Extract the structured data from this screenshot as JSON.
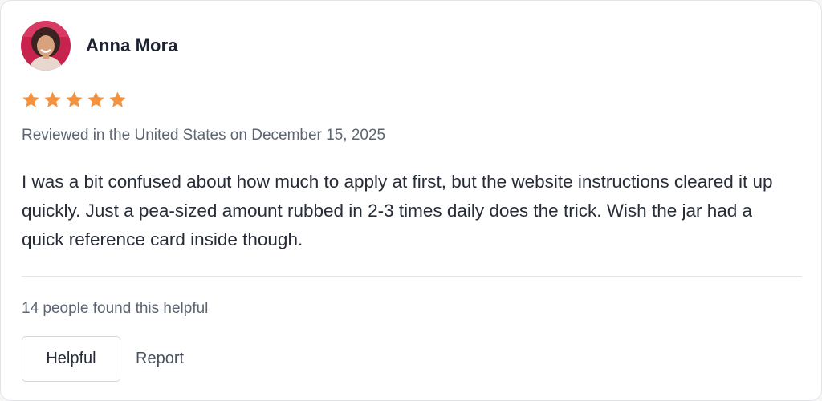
{
  "review": {
    "reviewer_name": "Anna Mora",
    "avatar_icon": "reviewer-photo",
    "rating": 5,
    "rating_max": 5,
    "star_color": "#f5923e",
    "meta": "Reviewed in the United States on December 15, 2025",
    "body": "I was a bit confused about how much to apply at first, but the website instructions cleared it up quickly. Just a pea-sized amount rubbed in 2-3 times daily does the trick. Wish the jar had a quick reference card inside though.",
    "helpful_count_text": "14 people found this helpful"
  },
  "actions": {
    "helpful_label": "Helpful",
    "report_label": "Report"
  }
}
